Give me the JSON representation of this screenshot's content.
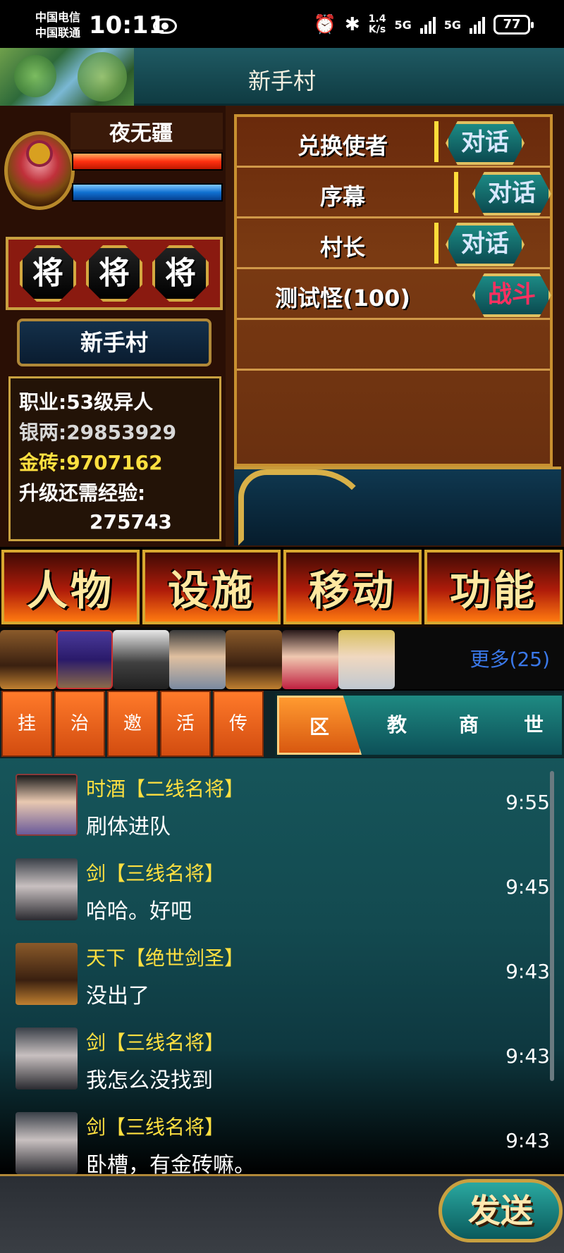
{
  "status_bar": {
    "carrier_1": "中国电信",
    "carrier_2": "中国联通",
    "time": "10:11",
    "net_speed_value": "1.4",
    "net_speed_unit": "K/s",
    "signal_1": "5G",
    "signal_2": "5G",
    "battery": "77"
  },
  "header": {
    "title": "新手村"
  },
  "character": {
    "name": "夜无疆",
    "generals": [
      "将",
      "将",
      "将"
    ],
    "location": "新手村",
    "job": "职业:53级异人",
    "silver": "银两:29853929",
    "gold": "金砖:9707162",
    "exp_label": "升级还需经验:",
    "exp_value": "275743"
  },
  "npcs": [
    {
      "name": "兑换使者",
      "action": "对话"
    },
    {
      "name": "序幕",
      "action": "对话"
    },
    {
      "name": "村长",
      "action": "对话"
    },
    {
      "name": "测试怪(100)",
      "action": "战斗"
    }
  ],
  "menu": [
    "人物",
    "设施",
    "移动",
    "功能"
  ],
  "party": {
    "more": "更多(25)"
  },
  "tabs": {
    "left": [
      "挂",
      "治",
      "邀",
      "活",
      "传"
    ],
    "right": [
      "区",
      "教",
      "商",
      "世"
    ],
    "active": "区"
  },
  "chat": [
    {
      "author": "时酒【二线名将】",
      "text": "刷体进队",
      "time": "9:55"
    },
    {
      "author": "剑【三线名将】",
      "text": "哈哈。好吧",
      "time": "9:45"
    },
    {
      "author": "天下【绝世剑圣】",
      "text": "没出了",
      "time": "9:43"
    },
    {
      "author": "剑【三线名将】",
      "text": "我怎么没找到",
      "time": "9:43"
    },
    {
      "author": "剑【三线名将】",
      "text": "卧槽，有金砖嘛。",
      "time": "9:43"
    }
  ],
  "input": {
    "send_label": "发送"
  }
}
